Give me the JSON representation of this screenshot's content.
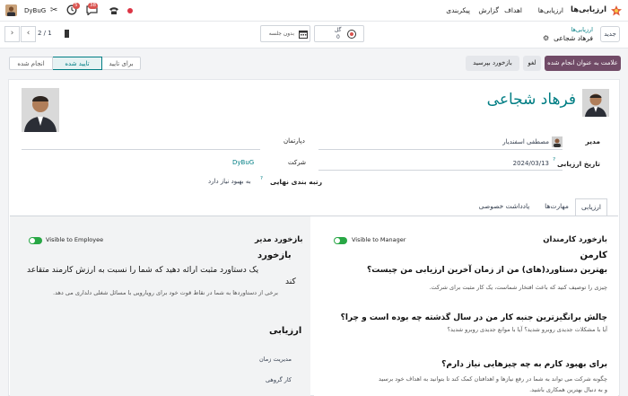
{
  "navbar": {
    "app_name": "ارزیابی‌ها",
    "menu": [
      "ارزیابی‌ها",
      "اهداف",
      "گزارش",
      "پیکربندی"
    ],
    "company": "DyBuG",
    "chat_badge": "5",
    "activity_badge": "38"
  },
  "control": {
    "new_button": "جدید",
    "breadcrumb_parent": "ارزیابی‌ها",
    "record_title": "فرهاد شجاعی",
    "timer_value": "0",
    "timer_label": "گل",
    "session_label": "بدون جلسه",
    "pager": "2 / 1"
  },
  "statusbar": {
    "mark_done": "علامت به عنوان انجام شده",
    "cancel": "لغو",
    "ask_feedback": "بازخورد بپرسید",
    "stages": [
      "برای تایید",
      "تایید شده",
      "انجام شده"
    ],
    "active_stage": "تایید شده"
  },
  "form": {
    "employee_name": "فرهاد شجاعی",
    "manager_label": "مدیر",
    "manager_value": "مصطفی اسفندیار",
    "appraisal_date_label": "تاریخ ارزیابی",
    "appraisal_date_help": "?",
    "appraisal_date_value": "2024/03/13",
    "department_label": "دپارتمان",
    "company_label": "شرکت",
    "company_value": "DyBuG",
    "final_rating_label": "رتبه بندی نهایی",
    "final_rating_help": "?",
    "final_rating_value": "به بهبود نیاز دارد"
  },
  "tabs": [
    "ارزیابی",
    "مهارت‌ها",
    "یادداشت خصوصی"
  ],
  "employee_feedback": {
    "title": "بازخورد کارمندان",
    "toggle_label": "Visible to Manager",
    "heading": "کارمن",
    "q1": "بهترین دستاورد(های) من از زمان آخرین ارزیابی من چیست؟",
    "q1_desc": "چیزی را توصیف کنید که باعث افتخار شماست، یک کار مثبت برای شرکت.",
    "q2": "چالش برانگیزترین جنبه کار من در سال گذشته چه بوده است و چرا؟",
    "q2_desc": "آیا با مشکلات جدیدی روبرو شدید؟ آیا با موانع جدیدی روبرو شدید؟",
    "q3": "برای بهبود کارم به چه چیزهایی نیاز دارم؟",
    "q3_desc_1": "چگونه شرکت می تواند به شما در رفع نیازها و اهدافتان کمک کند تا بتوانید به اهداف خود برسید",
    "q3_desc_2": "و به دنبال بهترین همکاری باشید."
  },
  "manager_feedback": {
    "title": "بازخورد مدیر",
    "toggle_label": "Visible to Employee",
    "heading": "بازخورد",
    "line1": "یک دستاورد مثبت ارائه دهید که شما را نسبت به ارزش کارمند متقاعد",
    "line2": "کند",
    "desc": "برخی از دستاوردها به شما در نقاط قوت خود برای رویارویی با مسائل شغلی دلداری می دهد.",
    "evaluation_heading": "ارزیابی",
    "eval_items": [
      "مدیریت زمان",
      "کار گروهی"
    ]
  },
  "colors": {
    "primary": "#714b67",
    "teal": "#017e84",
    "toggle_on": "#28a745"
  }
}
